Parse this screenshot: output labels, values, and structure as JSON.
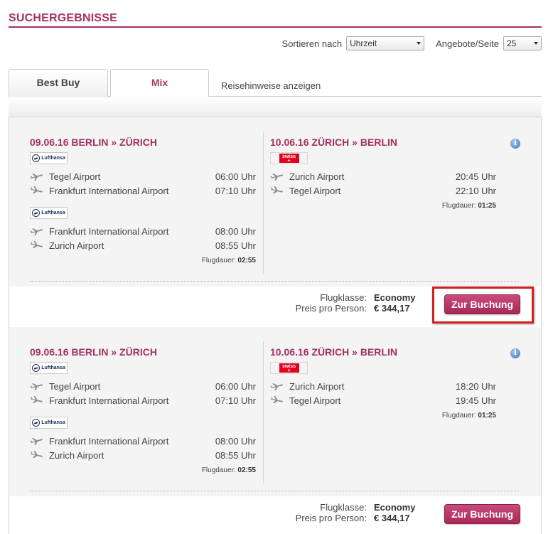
{
  "header": {
    "title": "SUCHERGEBNISSE"
  },
  "controls": {
    "sort_label": "Sortieren nach",
    "sort_value": "Uhrzeit",
    "per_page_label": "Angebote/Seite",
    "per_page_value": "25"
  },
  "tabs": [
    {
      "label": "Best Buy",
      "active": true
    },
    {
      "label": "Mix",
      "active": false
    }
  ],
  "travel_notes_link": "Reisehinweise anzeigen",
  "offers": [
    {
      "outbound": {
        "heading": "09.06.16 BERLIN » ZÜRICH",
        "segments": [
          {
            "airline": "Lufthansa",
            "from": "Tegel Airport",
            "dep": "06:00 Uhr",
            "to": "Frankfurt International Airport",
            "arr": "07:10 Uhr"
          },
          {
            "airline": "Lufthansa",
            "from": "Frankfurt International Airport",
            "dep": "08:00 Uhr",
            "to": "Zurich Airport",
            "arr": "08:55 Uhr"
          }
        ],
        "duration_label": "Flugdauer:",
        "duration": "02:55"
      },
      "return": {
        "heading": "10.06.16 ZÜRICH » BERLIN",
        "segments": [
          {
            "airline": "swiss",
            "from": "Zurich Airport",
            "dep": "20:45 Uhr",
            "to": "Tegel Airport",
            "arr": "22:10 Uhr"
          }
        ],
        "duration_label": "Flugdauer:",
        "duration": "01:25"
      },
      "class_label": "Flugklasse:",
      "class_value": "Economy",
      "price_label": "Preis pro Person:",
      "price_value": "€ 344,17",
      "book_label": "Zur Buchung"
    },
    {
      "outbound": {
        "heading": "09.06.16 BERLIN » ZÜRICH",
        "segments": [
          {
            "airline": "Lufthansa",
            "from": "Tegel Airport",
            "dep": "06:00 Uhr",
            "to": "Frankfurt International Airport",
            "arr": "07:10 Uhr"
          },
          {
            "airline": "Lufthansa",
            "from": "Frankfurt International Airport",
            "dep": "08:00 Uhr",
            "to": "Zurich Airport",
            "arr": "08:55 Uhr"
          }
        ],
        "duration_label": "Flugdauer:",
        "duration": "02:55"
      },
      "return": {
        "heading": "10.06.16 ZÜRICH » BERLIN",
        "segments": [
          {
            "airline": "swiss",
            "from": "Zurich Airport",
            "dep": "18:20 Uhr",
            "to": "Tegel Airport",
            "arr": "19:45 Uhr"
          }
        ],
        "duration_label": "Flugdauer:",
        "duration": "01:25"
      },
      "class_label": "Flugklasse:",
      "class_value": "Economy",
      "price_label": "Preis pro Person:",
      "price_value": "€ 344,17",
      "book_label": "Zur Buchung"
    }
  ],
  "logos": {
    "lufthansa": "Lufthansa",
    "swiss": "swiss"
  },
  "colors": {
    "brand": "#a33060",
    "button": "#b8366a",
    "highlight": "#d21f1f"
  }
}
